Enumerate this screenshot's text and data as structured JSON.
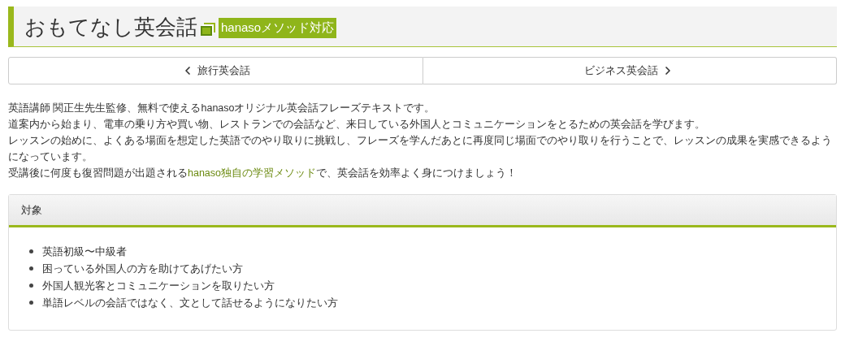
{
  "header": {
    "title": "おもてなし英会話",
    "badge": "hanasoメソッド対応"
  },
  "nav": [
    {
      "label": "旅行英会話",
      "kind": "prev"
    },
    {
      "label": "ビジネス英会話",
      "kind": "next"
    }
  ],
  "intro": [
    {
      "text": "英語講師 関正生先生監修、無料で使えるhanasoオリジナル英会話フレーズテキストです。"
    },
    {
      "text": "道案内から始まり、電車の乗り方や買い物、レストランでの会話など、来日している外国人とコミュニケーションをとるための英会話を学びます。"
    },
    {
      "text": "レッスンの始めに、よくある場面を想定した英語でのやり取りに挑戦し、フレーズを学んだあとに再度同じ場面でのやり取りを行うことで、レッスンの成果を実感できるようになっています。"
    },
    {
      "text": "受講後に何度も復習問題が出題される",
      "link": "hanaso独自の学習メソッド",
      "after": "で、英会話を効率よく身につけましょう！"
    }
  ],
  "target_panel": {
    "heading": "対象",
    "items": [
      "英語初級〜中級者",
      "困っている外国人の方を助けてあげたい方",
      "外国人観光客とコミュニケーションを取りたい方",
      "単語レベルの会話ではなく、文として話せるようになりたい方"
    ]
  }
}
